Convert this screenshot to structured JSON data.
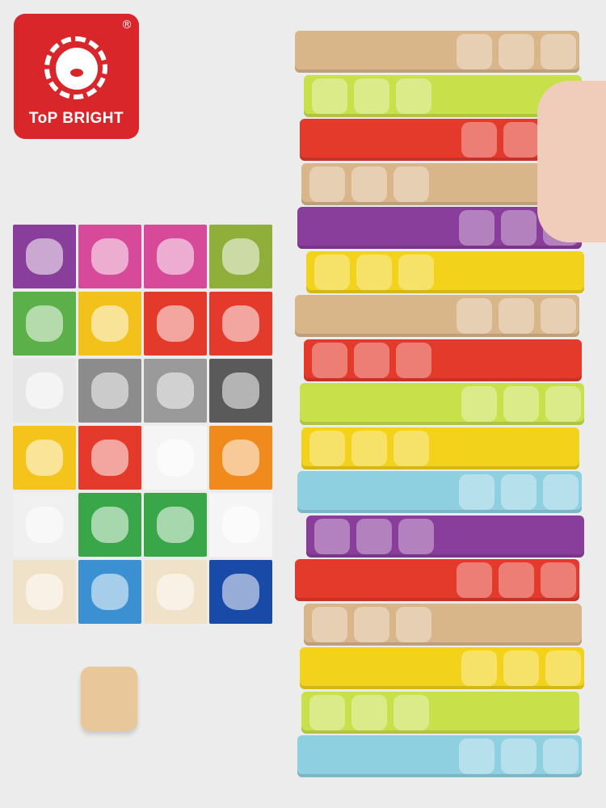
{
  "logo": {
    "brand": "ToP BRIGHT",
    "registered": "®",
    "color": "#d9262b"
  },
  "cards": [
    [
      "#8a3e9c",
      "#d74a9a",
      "#d74a9a",
      "#8fae3a"
    ],
    [
      "#5bb04a",
      "#f2c21a",
      "#e33a2c",
      "#e33a2c"
    ],
    [
      "#e6e6e6",
      "#8c8c8c",
      "#9a9a9a",
      "#5a5a5a"
    ],
    [
      "#f4c41c",
      "#e33a2c",
      "#f5f5f5",
      "#f08a1c"
    ],
    [
      "#f0f0f0",
      "#3aa64a",
      "#3aa64a",
      "#f5f5f5"
    ],
    [
      "#f0e2c8",
      "#3a90d0",
      "#f0e2c8",
      "#1a4aa8"
    ]
  ],
  "tower": [
    "#d9b58a",
    "#c8e04a",
    "#e33a2c",
    "#d9b58a",
    "#8a3e9c",
    "#f2d21a",
    "#d9b58a",
    "#e33a2c",
    "#c8e04a",
    "#f2d21a",
    "#8fd0e0",
    "#8a3e9c",
    "#e33a2c",
    "#d9b58a",
    "#f2d21a",
    "#c8e04a",
    "#8fd0e0"
  ]
}
